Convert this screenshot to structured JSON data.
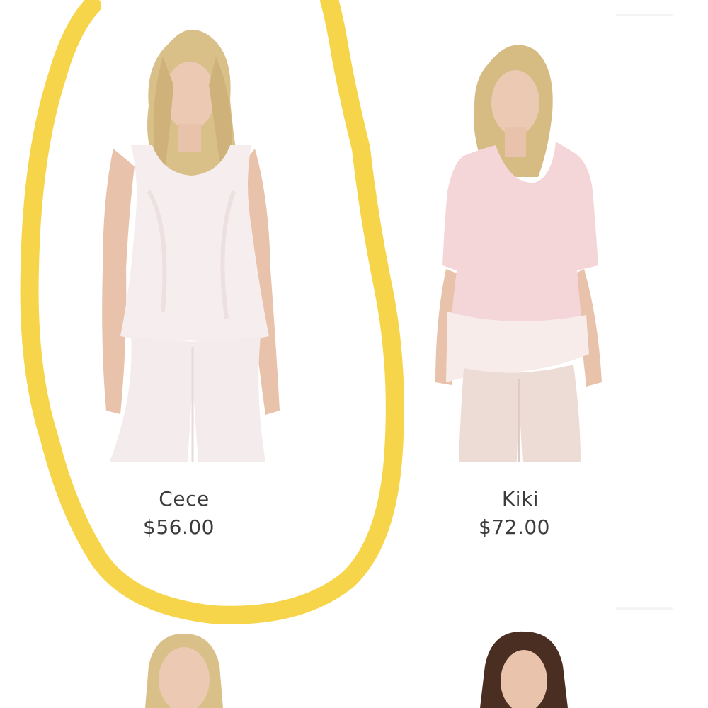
{
  "products": [
    {
      "name": "Cece",
      "price": "$56.00",
      "image_icon": "model-photo-icon",
      "garment_color": "#f6eeee"
    },
    {
      "name": "Kiki",
      "price": "$72.00",
      "image_icon": "model-photo-icon",
      "garment_color": "#f5d6d8"
    },
    {
      "name": "",
      "price": "",
      "image_icon": "model-photo-icon",
      "garment_color": "#f6eeee"
    },
    {
      "name": "",
      "price": "",
      "image_icon": "model-photo-icon",
      "garment_color": "#f5d6d8"
    }
  ],
  "annotation": {
    "shape": "hand-drawn-circle",
    "color": "#f7d54a",
    "target": "Cece"
  },
  "colors": {
    "background": "#ffffff",
    "text": "#3c3c3c",
    "skin": "#e8c2aa",
    "blonde_hair": "#d9bf88",
    "dark_hair": "#4a2e22"
  }
}
